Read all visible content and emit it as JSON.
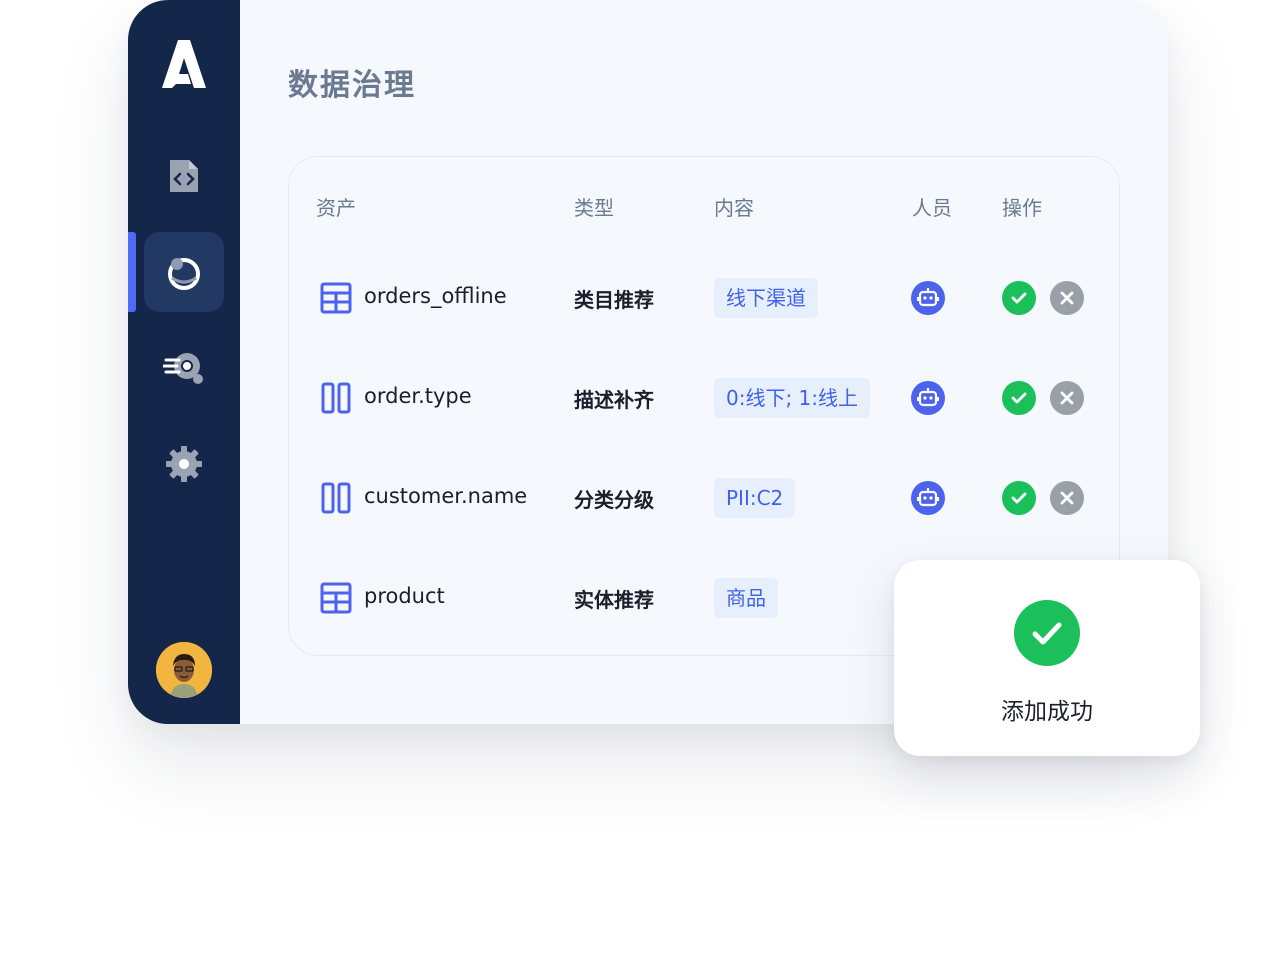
{
  "page": {
    "title": "数据治理"
  },
  "sidebar": {
    "items": [
      {
        "name": "code-file",
        "icon": "code-file-icon"
      },
      {
        "name": "governance",
        "icon": "donut-icon",
        "active": true
      },
      {
        "name": "explore",
        "icon": "search-speed-icon"
      },
      {
        "name": "settings",
        "icon": "gear-icon"
      }
    ]
  },
  "table": {
    "columns": [
      "资产",
      "类型",
      "内容",
      "人员",
      "操作"
    ],
    "rows": [
      {
        "asset": "orders_offline",
        "asset_kind": "table",
        "type": "类目推荐",
        "content": "线下渠道",
        "person": "robot-icon"
      },
      {
        "asset": "order.type",
        "asset_kind": "column",
        "type": "描述补齐",
        "content": "0:线下; 1:线上",
        "person": "robot-icon"
      },
      {
        "asset": "customer.name",
        "asset_kind": "column",
        "type": "分类分级",
        "content": "PII:C2",
        "person": "robot-icon"
      },
      {
        "asset": "product",
        "asset_kind": "table",
        "type": "实体推荐",
        "content": "商品",
        "person": ""
      }
    ]
  },
  "toast": {
    "message": "添加成功"
  },
  "colors": {
    "sidebar": "#14274a",
    "accent": "#4d6bf5",
    "success": "#1cc05a",
    "reject": "#9aa0a8",
    "tag_bg": "#e8effc",
    "tag_text": "#3f62e8"
  }
}
